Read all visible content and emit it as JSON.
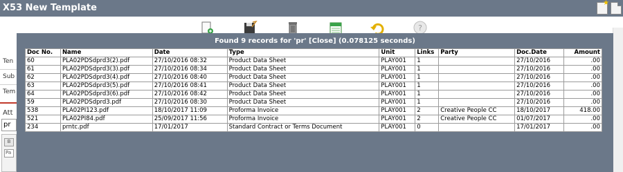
{
  "window": {
    "title": "X53 New Template"
  },
  "background_form": {
    "labels": [
      "Ten",
      "Sub",
      "Tem",
      "Att"
    ],
    "input_value": "pr",
    "editor_buttons": [
      "B",
      "Pa"
    ]
  },
  "colors": {
    "titlebar": "#6b7889",
    "overlay": "#6b7889",
    "accent_red": "#c0392b"
  },
  "toolbar": {
    "icons": [
      "new-document-icon",
      "save-icon",
      "trash-icon",
      "calendar-icon",
      "undo-icon",
      "help-icon"
    ],
    "help_label": "?"
  },
  "search_results": {
    "header": "Found 9 records for 'pr' [Close] (0.078125 seconds)",
    "columns": [
      "Doc No.",
      "Name",
      "Date",
      "Type",
      "Unit",
      "Links",
      "Party",
      "Doc.Date",
      "Amount"
    ],
    "rows": [
      [
        "60",
        "PLA02PDSdprd3(2).pdf",
        "27/10/2016 08:32",
        "Product Data Sheet",
        "PLAY001",
        "1",
        "",
        "27/10/2016",
        ".00"
      ],
      [
        "61",
        "PLA02PDSdprd3(3).pdf",
        "27/10/2016 08:34",
        "Product Data Sheet",
        "PLAY001",
        "1",
        "",
        "27/10/2016",
        ".00"
      ],
      [
        "62",
        "PLA02PDSdprd3(4).pdf",
        "27/10/2016 08:40",
        "Product Data Sheet",
        "PLAY001",
        "1",
        "",
        "27/10/2016",
        ".00"
      ],
      [
        "63",
        "PLA02PDSdprd3(5).pdf",
        "27/10/2016 08:41",
        "Product Data Sheet",
        "PLAY001",
        "1",
        "",
        "27/10/2016",
        ".00"
      ],
      [
        "64",
        "PLA02PDSdprd3(6).pdf",
        "27/10/2016 08:42",
        "Product Data Sheet",
        "PLAY001",
        "1",
        "",
        "27/10/2016",
        ".00"
      ],
      [
        "59",
        "PLA02PDSdprd3.pdf",
        "27/10/2016 08:30",
        "Product Data Sheet",
        "PLAY001",
        "1",
        "",
        "27/10/2016",
        ".00"
      ],
      [
        "538",
        "PLA02PI123.pdf",
        "18/10/2017 11:09",
        "Proforma Invoice",
        "PLAY001",
        "2",
        "Creative People CC",
        "18/10/2017",
        "418.00"
      ],
      [
        "521",
        "PLA02PI84.pdf",
        "25/09/2017 11:56",
        "Proforma Invoice",
        "PLAY001",
        "2",
        "Creative People CC",
        "01/07/2017",
        ".00"
      ],
      [
        "234",
        "prntc.pdf",
        "17/01/2017",
        "Standard Contract or Terms Document",
        "PLAY001",
        "0",
        "",
        "17/01/2017",
        ".00"
      ]
    ]
  }
}
